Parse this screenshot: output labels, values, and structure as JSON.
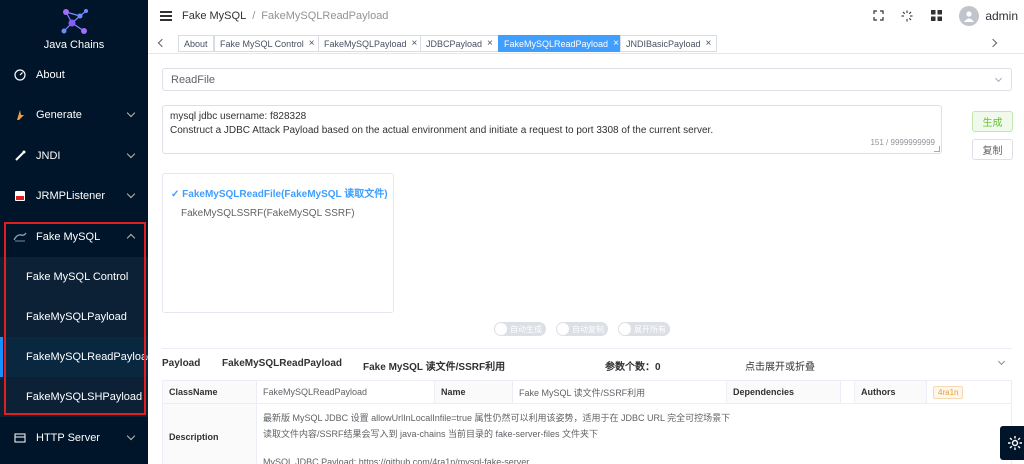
{
  "app": {
    "logo_text": "Java Chains"
  },
  "sidebar": {
    "items": [
      {
        "label": "About",
        "icon": "dashboard-icon"
      },
      {
        "label": "Generate",
        "icon": "generate-icon"
      },
      {
        "label": "JNDI",
        "icon": "jndi-icon"
      },
      {
        "label": "JRMPListener",
        "icon": "jrmp-icon"
      },
      {
        "label": "Fake MySQL",
        "icon": "mysql-icon"
      },
      {
        "label": "HTTP Server",
        "icon": "http-server-icon"
      }
    ],
    "submenu": [
      "Fake MySQL Control",
      "FakeMySQLPayload",
      "FakeMySQLReadPayload",
      "FakeMySQLSHPayload"
    ],
    "active_submenu": "FakeMySQLReadPayload"
  },
  "header": {
    "breadcrumb": [
      "Fake MySQL",
      "FakeMySQLReadPayload"
    ],
    "user": "admin"
  },
  "tags": [
    {
      "label": "About",
      "closable": false
    },
    {
      "label": "Fake MySQL Control",
      "closable": true
    },
    {
      "label": "FakeMySQLPayload",
      "closable": true
    },
    {
      "label": "JDBCPayload",
      "closable": true
    },
    {
      "label": "FakeMySQLReadPayload",
      "closable": true,
      "active": true
    },
    {
      "label": "JNDIBasicPayload",
      "closable": true
    }
  ],
  "form": {
    "select_value": "ReadFile",
    "textarea_line1": "mysql jdbc username: f828328",
    "textarea_line2": "Construct a JDBC Attack Payload based on the actual environment and initiate a request to port 3308 of the current server.",
    "char_counter": "151 / 9999999999",
    "generate_label": "生成",
    "copy_label": "复制"
  },
  "tree": {
    "selected": "FakeMySQLReadFile(FakeMySQL 读取文件)",
    "other": "FakeMySQLSSRF(FakeMySQL SSRF)"
  },
  "switches": [
    "自动生成",
    "自动复制",
    "展开所有"
  ],
  "payload_summary": {
    "label": "Payload",
    "name": "FakeMySQLReadPayload",
    "title": "Fake MySQL 读文件/SSRF利用",
    "param_count": "参数个数：0",
    "toggle": "点击展开或折叠"
  },
  "details": {
    "classname_label": "ClassName",
    "classname": "FakeMySQLReadPayload",
    "name_label": "Name",
    "name": "Fake MySQL 读文件/SSRF利用",
    "dependencies_label": "Dependencies",
    "authors_label": "Authors",
    "author": "4ra1n",
    "description_label": "Description",
    "description_1": "最新版 MySQL JDBC 设置 allowUrlInLocalInfile=true 属性仍然可以利用该姿势，适用于在 JDBC URL 完全可控场景下",
    "description_2": "读取文件内容/SSRF结果会写入到 java-chains 当前目录的 fake-server-files 文件夹下",
    "description_3": "MySQL JDBC Payload: https://github.com/4ra1n/mysql-fake-server"
  },
  "colors": {
    "sidebar_bg": "#001529",
    "accent": "#409eff",
    "highlight_border": "#e02020",
    "success": "#67c23a"
  }
}
